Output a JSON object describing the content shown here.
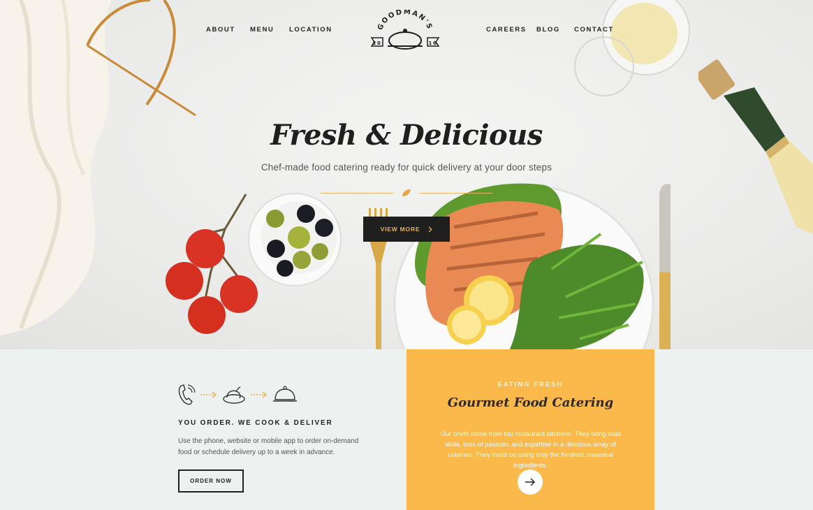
{
  "nav": {
    "left": [
      "ABOUT",
      "MENU",
      "LOCATION"
    ],
    "right": [
      "CAREERS",
      "BLOG",
      "CONTACT"
    ]
  },
  "logo": {
    "name": "GOODMAN'S",
    "year_left": "20",
    "year_right": "16"
  },
  "hero": {
    "title": "Fresh & Delicious",
    "subtitle": "Chef-made food catering ready for quick delivery at your door steps",
    "button": "VIEW MORE",
    "button_icon": "chevron-right-icon"
  },
  "order": {
    "steps": [
      "phone-icon",
      "dotted-arrow-icon",
      "chicken-dish-icon",
      "dotted-arrow-icon",
      "cloche-icon"
    ],
    "title": "YOU ORDER. WE COOK & DELIVER",
    "text": "Use the phone, website or mobile app to order on-demand food or schedule delivery up to a week in advance.",
    "button": "ORDER NOW"
  },
  "catering": {
    "eyebrow": "EATING FRESH",
    "title": "Gourmet Food Catering",
    "text": "Our chefs come from top restaurant kitchens. They bring mad skills, tons of passion, and expertise in a delicious array of cuisines. They insist on using only the freshest seasonal ingredients.",
    "arrow_icon": "arrow-right-icon"
  },
  "colors": {
    "accent": "#fbb84b",
    "dark": "#1f1f1f",
    "gold": "#e9b25a",
    "lower_bg": "#edf1f0"
  }
}
